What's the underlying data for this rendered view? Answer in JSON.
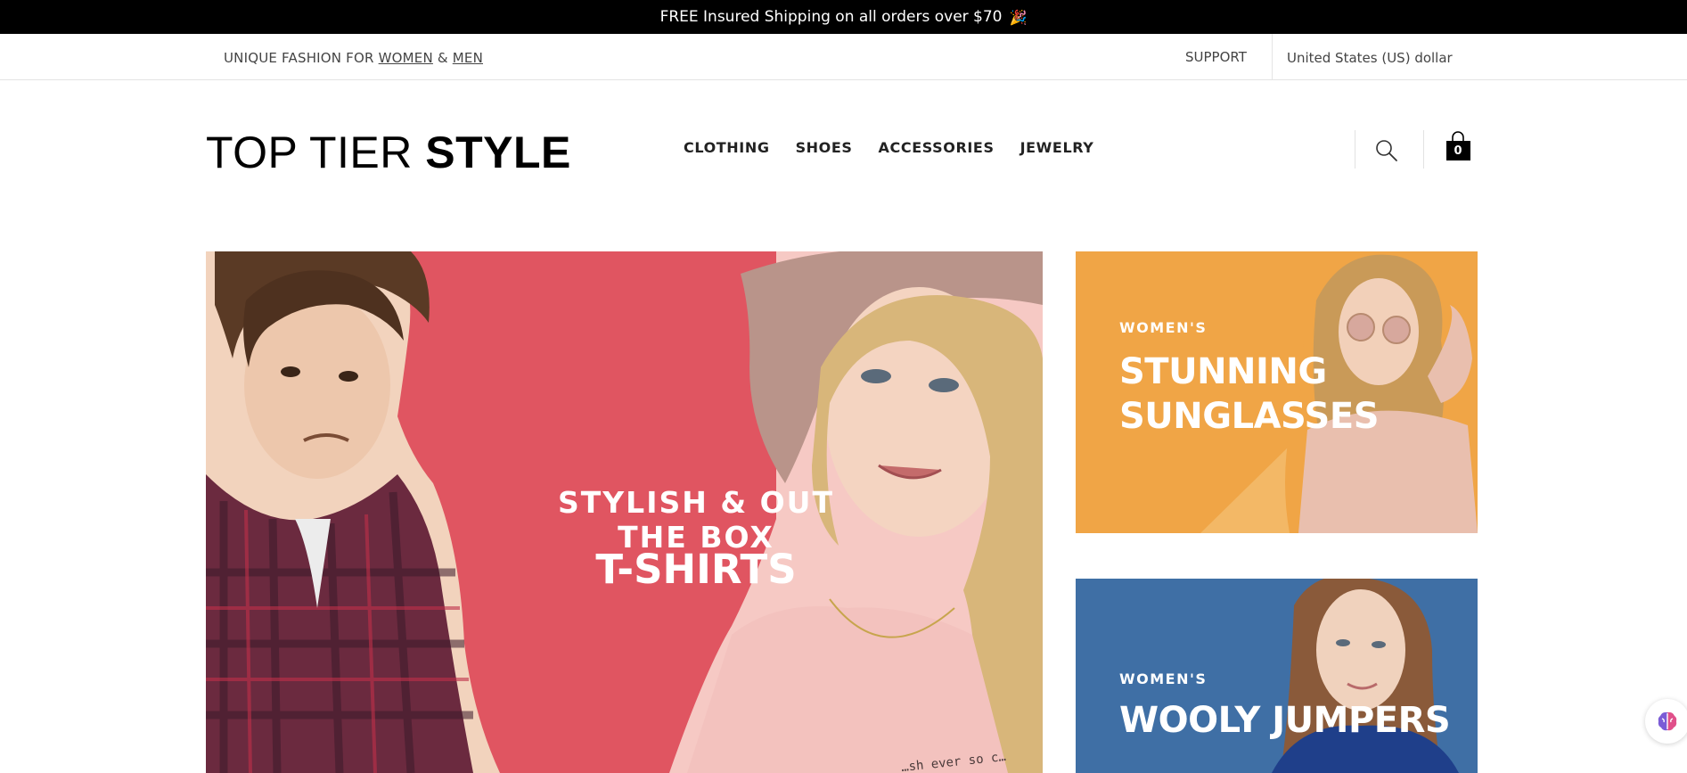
{
  "promo": {
    "text": "FREE Insured Shipping on all orders over $70",
    "emoji": "🎉"
  },
  "utility": {
    "tagline_prefix": "UNIQUE FASHION FOR ",
    "women_link": "WOMEN",
    "amp": " & ",
    "men_link": "MEN",
    "support": "SUPPORT",
    "currency": "United States (US) dollar"
  },
  "header": {
    "logo_light": "TOP TIER ",
    "logo_bold": "STYLE",
    "nav": [
      "CLOTHING",
      "SHOES",
      "ACCESSORIES",
      "JEWELRY"
    ],
    "cart_count": "0"
  },
  "hero": {
    "eyebrow": "STYLISH & OUT THE BOX",
    "title": "T-SHIRTS",
    "background": "#e05561",
    "tee_print": "…sh ever so c…"
  },
  "cards": [
    {
      "eyebrow": "WOMEN'S",
      "title_line1": "STUNNING",
      "title_line2": "SUNGLASSES",
      "background": "#f0a546"
    },
    {
      "eyebrow": "WOMEN'S",
      "title": "WOOLY JUMPERS",
      "background": "#3f6fa5"
    }
  ],
  "icons": {
    "search": "search-icon",
    "cart": "shopping-bag-icon",
    "assistant": "brain-icon"
  }
}
